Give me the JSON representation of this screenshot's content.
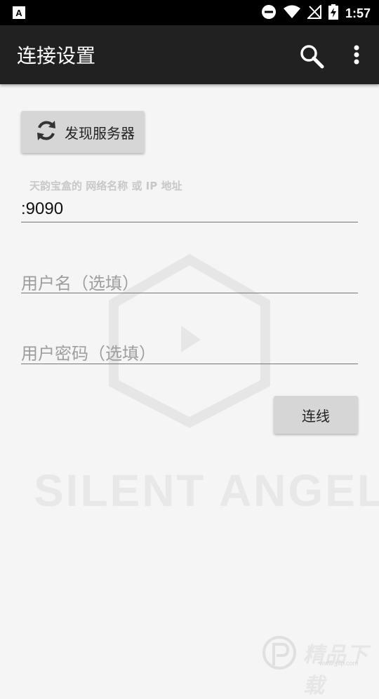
{
  "status_bar": {
    "time": "1:57",
    "icons": [
      "app-a-icon",
      "do-not-disturb-icon",
      "wifi-icon",
      "no-signal-icon",
      "battery-charging-icon"
    ]
  },
  "app_bar": {
    "title": "连接设置",
    "background": "#212121",
    "icons": [
      "search-icon",
      "more-vert-icon"
    ]
  },
  "discover": {
    "label": "发现服务器",
    "icon": "refresh-icon"
  },
  "server_field": {
    "label": "天韵宝盒的 网络名称 或 IP 地址",
    "value": ":9090"
  },
  "username_field": {
    "placeholder": "用户名（选填）",
    "value": ""
  },
  "password_field": {
    "placeholder": "用户密码（选填）",
    "value": ""
  },
  "connect_button": {
    "label": "连线"
  },
  "watermark": {
    "brand_text": "SILENT ANGEL",
    "site_text": "精品下载",
    "site_sub": "www.jplp.com"
  }
}
